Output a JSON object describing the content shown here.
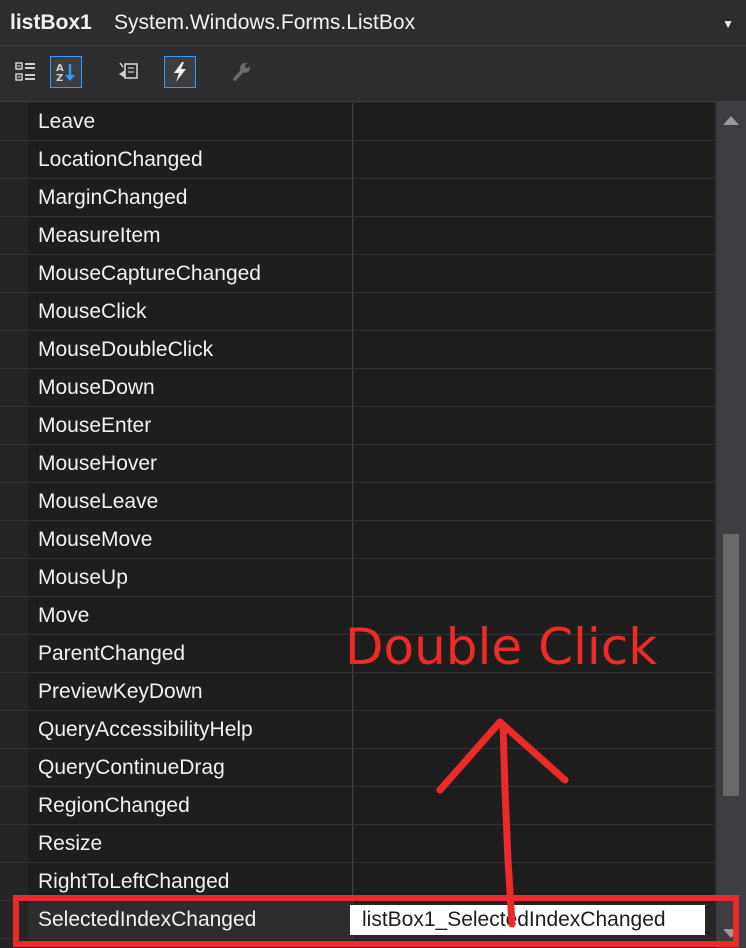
{
  "header": {
    "component_name": "listBox1",
    "component_type": "System.Windows.Forms.ListBox",
    "dropdown_icon": "chevron-down-icon"
  },
  "toolbar": {
    "buttons": [
      {
        "name": "categorized-view-button",
        "icon": "categorized-icon",
        "active": false
      },
      {
        "name": "alphabetical-view-button",
        "icon": "sort-az-icon",
        "active": true
      },
      {
        "name": "properties-view-button",
        "icon": "properties-icon",
        "active": false
      },
      {
        "name": "events-view-button",
        "icon": "lightning-icon",
        "active": true
      },
      {
        "name": "property-pages-button",
        "icon": "wrench-icon",
        "active": false
      }
    ]
  },
  "events": [
    {
      "name": "Leave",
      "value": ""
    },
    {
      "name": "LocationChanged",
      "value": ""
    },
    {
      "name": "MarginChanged",
      "value": ""
    },
    {
      "name": "MeasureItem",
      "value": ""
    },
    {
      "name": "MouseCaptureChanged",
      "value": ""
    },
    {
      "name": "MouseClick",
      "value": ""
    },
    {
      "name": "MouseDoubleClick",
      "value": ""
    },
    {
      "name": "MouseDown",
      "value": ""
    },
    {
      "name": "MouseEnter",
      "value": ""
    },
    {
      "name": "MouseHover",
      "value": ""
    },
    {
      "name": "MouseLeave",
      "value": ""
    },
    {
      "name": "MouseMove",
      "value": ""
    },
    {
      "name": "MouseUp",
      "value": ""
    },
    {
      "name": "Move",
      "value": ""
    },
    {
      "name": "ParentChanged",
      "value": ""
    },
    {
      "name": "PreviewKeyDown",
      "value": ""
    },
    {
      "name": "QueryAccessibilityHelp",
      "value": ""
    },
    {
      "name": "QueryContinueDrag",
      "value": ""
    },
    {
      "name": "RegionChanged",
      "value": ""
    },
    {
      "name": "Resize",
      "value": ""
    },
    {
      "name": "RightToLeftChanged",
      "value": ""
    },
    {
      "name": "SelectedIndexChanged",
      "value": "listBox1_SelectedIndexChanged",
      "selected": true
    }
  ],
  "annotation": {
    "text": "Double Click",
    "color": "#ec2a2a"
  },
  "colors": {
    "background": "#252526",
    "row_background": "#1e1e1e",
    "accent": "#3399ff",
    "annotation": "#ec2a2a"
  }
}
